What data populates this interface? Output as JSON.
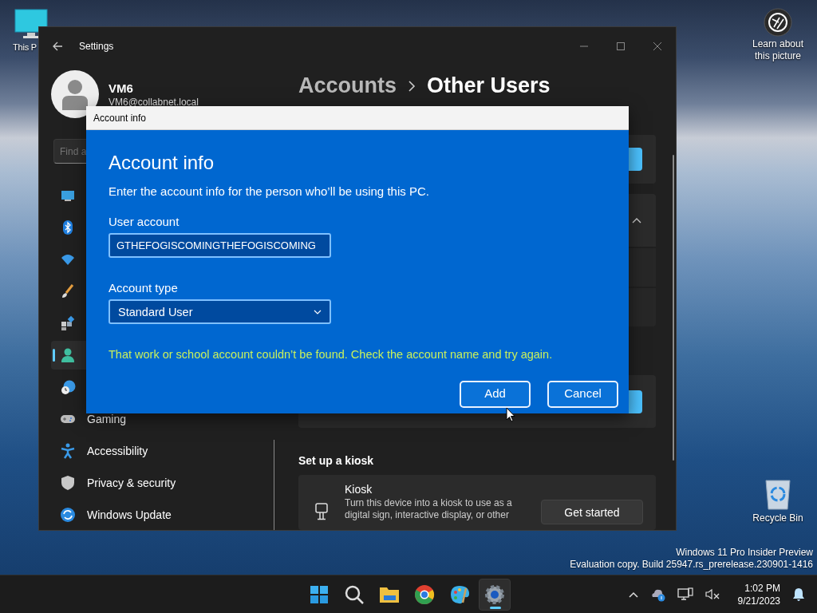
{
  "desktop_icons": [
    {
      "label": "This P"
    },
    {
      "label": "Learn about this picture"
    },
    {
      "label": "Recycle Bin"
    }
  ],
  "settings_window": {
    "title": "Settings",
    "user": {
      "name": "VM6",
      "email": "VM6@collabnet.local"
    },
    "search": {
      "placeholder": "Find a"
    },
    "nav": [
      {
        "selected": false
      },
      {
        "selected": false
      },
      {
        "selected": false
      },
      {
        "selected": false
      },
      {
        "selected": false
      },
      {
        "selected": true
      },
      {
        "selected": false
      },
      {
        "label": "Gaming",
        "selected": false
      },
      {
        "label": "Accessibility",
        "selected": false
      },
      {
        "label": "Privacy & security",
        "selected": false
      },
      {
        "label": "Windows Update",
        "selected": false
      }
    ],
    "breadcrumb": [
      "Accounts",
      "Other Users"
    ],
    "other_users_card": {
      "expanded": true
    },
    "kiosk_section": {
      "title": "Set up a kiosk",
      "card_title": "Kiosk",
      "card_description": "Turn this device into a kiosk to use as a digital sign, interactive display, or other",
      "button": "Get started"
    }
  },
  "dialog": {
    "title": "Account info",
    "heading": "Account info",
    "description": "Enter the account info for the person who’ll be using this PC.",
    "fields": [
      {
        "kind": "text",
        "label": "User account",
        "value": "GTHEFOGISCOMINGTHEFOGISCOMING"
      },
      {
        "kind": "dropdown",
        "label": "Account type",
        "value": "Standard User"
      }
    ],
    "error": "That work or school account couldn’t be found. Check the account name and try again.",
    "buttons": [
      "Add",
      "Cancel"
    ]
  },
  "build_info": [
    "Windows 11 Pro Insider Preview",
    "Evaluation copy. Build 25947.rs_prerelease.230901-1416"
  ],
  "taskbar": {
    "apps": [
      {
        "selected": false
      },
      {
        "selected": false
      },
      {
        "selected": false
      },
      {
        "selected": false
      },
      {
        "selected": false
      },
      {
        "selected": true
      }
    ],
    "clock": {
      "time": "1:02 PM",
      "date": "9/21/2023"
    }
  }
}
